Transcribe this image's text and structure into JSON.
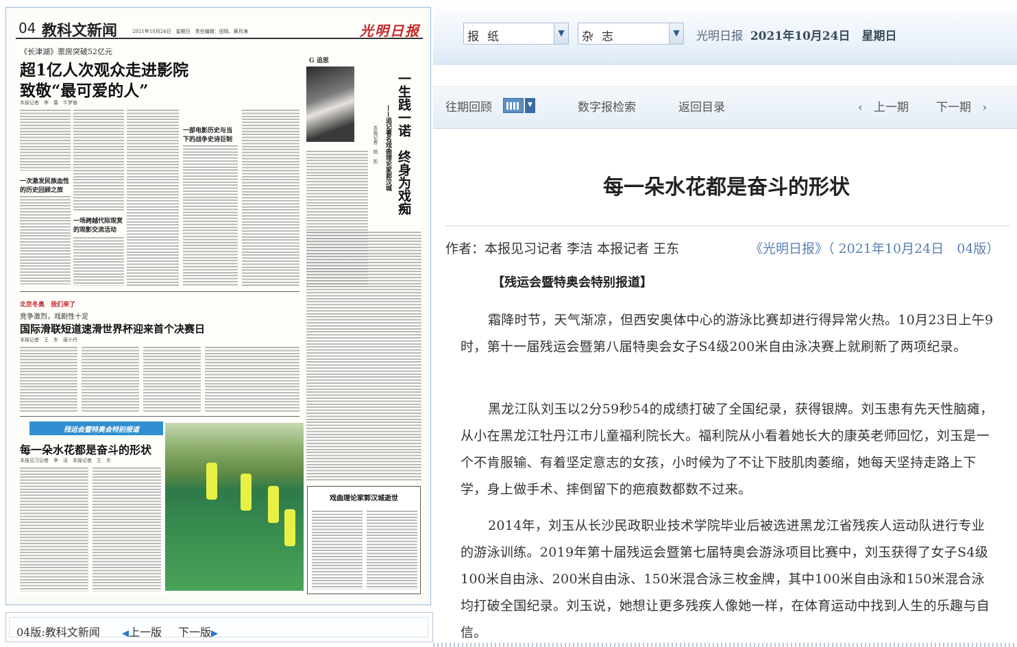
{
  "paper": {
    "page_no": "04",
    "page_name": "教科文新闻",
    "masthead_info": "2021年10月24日　星期日　责任编辑：田晓、黄月涛",
    "logo": "光明日报",
    "story1": {
      "kicker": "《长津湖》票房突破52亿元",
      "title_line1": "超1亿人次观众走进影院",
      "title_line2": "致敬“最可爱的人”",
      "byline": "本报记者　李　蕾　牛梦笛",
      "sub1": "一次激发民族血性的历史回顾之旅",
      "sub2": "一场跨越代际观赏的观影交流活动",
      "sub3": "一部电影历史与当下的战争史诗巨制"
    },
    "story2": {
      "tag": "北京冬奥　我们来了",
      "kicker": "竞争激烈，戏剧性十足",
      "title": "国际滑联短道速滑世界杯迎来首个决赛日",
      "byline": "本报记者　王　东　唐小丹"
    },
    "story3": {
      "banner": "残运会暨特奥会特别报道",
      "title": "每一朵水花都是奋斗的形状",
      "byline": "本报见习记者　李　洁　本报记者　王　东"
    },
    "story4": {
      "section": "G 追思",
      "vertical_title": "一生践一诺　终身为戏痴",
      "vertical_sub": "——追记著名戏曲理论家郭汉城",
      "byline": "本报记者　杨　凯",
      "box_title": "戏曲理论家郭汉城逝世"
    }
  },
  "paper_footer": {
    "label": "04版:教科文新闻",
    "prev": "上一版",
    "next": "下一版"
  },
  "topbar": {
    "select1": "报纸",
    "select2": "杂志",
    "paper_name": "光明日报",
    "date": "2021年10月24日　星期日"
  },
  "navbar": {
    "history": "往期回顾",
    "search": "数字报检索",
    "back": "返回目录",
    "prev_issue": "上一期",
    "next_issue": "下一期"
  },
  "article": {
    "title": "每一朵水花都是奋斗的形状",
    "author": "作者：本报见习记者 李洁 本报记者 王东",
    "source": "《光明日报》（ 2021年10月24日　04版）",
    "tag": "【残运会暨特奥会特别报道】",
    "p1": "霜降时节，天气渐凉，但西安奥体中心的游泳比赛却进行得异常火热。10月23日上午9时，第十一届残运会暨第八届特奥会女子S4级200米自由泳决赛上就刷新了两项纪录。",
    "p2": "黑龙江队刘玉以2分59秒54的成绩打破了全国纪录，获得银牌。刘玉患有先天性脑瘫，从小在黑龙江牡丹江市儿童福利院长大。福利院从小看着她长大的康英老师回忆，刘玉是一个不肯服输、有着坚定意志的女孩，小时候为了不让下肢肌肉萎缩，她每天坚持走路上下学，身上做手术、摔倒留下的疤痕数都数不过来。",
    "p3": "2014年，刘玉从长沙民政职业技术学院毕业后被选进黑龙江省残疾人运动队进行专业的游泳训练。2019年第十届残运会暨第七届特奥会游泳项目比赛中，刘玉获得了女子S4级100米自由泳、200米自由泳、150米混合泳三枚金牌，其中100米自由泳和150米混合泳均打破全国纪录。刘玉说，她想让更多残疾人像她一样，在体育运动中找到人生的乐趣与自信。"
  },
  "colors": {
    "accent_blue": "#2a78c8",
    "source_blue": "#5a7fb0",
    "logo_red": "#c62828"
  }
}
